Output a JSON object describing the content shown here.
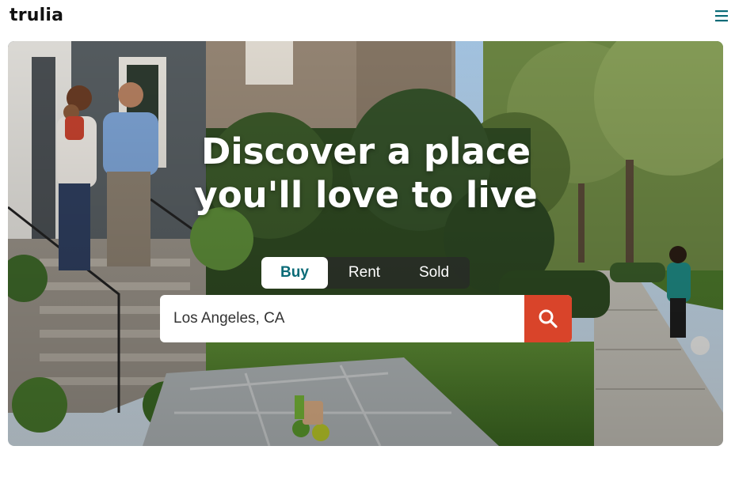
{
  "header": {
    "logo_text": "trulia",
    "menu_icon": "hamburger-menu-icon"
  },
  "hero": {
    "headline": "Discover a place you'll love to live",
    "tabs": [
      {
        "label": "Buy",
        "active": true
      },
      {
        "label": "Rent",
        "active": false
      },
      {
        "label": "Sold",
        "active": false
      }
    ],
    "search": {
      "value": "Los Angeles, CA",
      "button_icon": "search-icon"
    }
  },
  "colors": {
    "brand_teal": "#0a6b77",
    "search_button": "#d9442a"
  }
}
